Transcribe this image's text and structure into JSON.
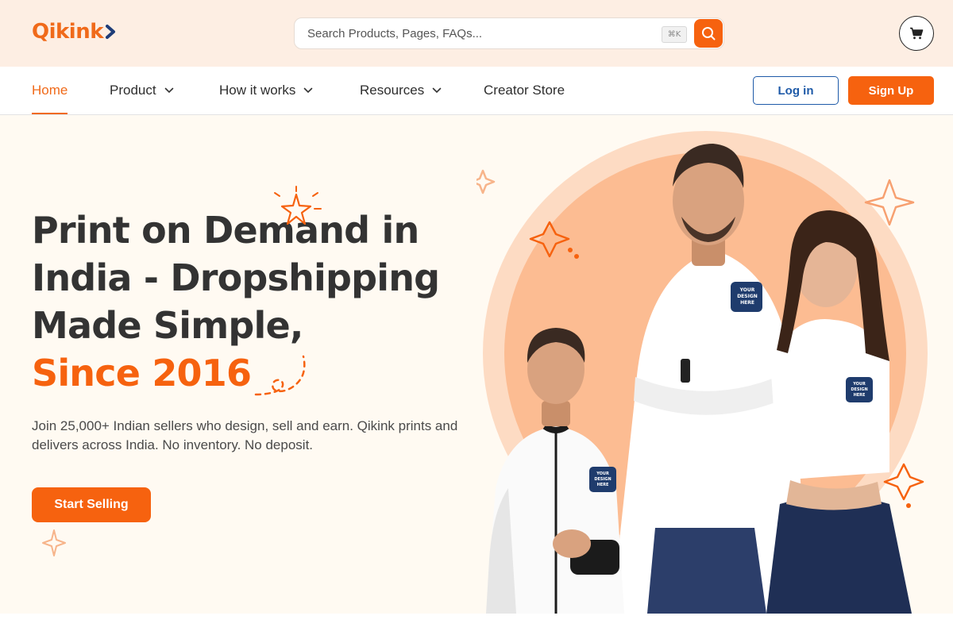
{
  "header": {
    "logo_text": "Qikink",
    "search": {
      "placeholder": "Search Products, Pages, FAQs...",
      "shortcut": "⌘K"
    }
  },
  "nav": {
    "items": [
      {
        "label": "Home",
        "active": true
      },
      {
        "label": "Product",
        "has_dropdown": true
      },
      {
        "label": "How it works",
        "has_dropdown": true
      },
      {
        "label": "Resources",
        "has_dropdown": true
      },
      {
        "label": "Creator Store",
        "has_dropdown": false
      }
    ],
    "login_label": "Log in",
    "signup_label": "Sign Up"
  },
  "hero": {
    "headline_lines": [
      "Print on Demand in",
      "India - Dropshipping",
      "Made Simple,"
    ],
    "highlight": "Since 2016",
    "subtext": "Join 25,000+ Indian sellers who design, sell and earn. Qikink prints and delivers across India. No inventory. No deposit.",
    "cta_label": "Start Selling",
    "tshirt_badge_text": "YOUR DESIGN HERE"
  },
  "colors": {
    "brand_orange": "#f6620f",
    "brand_blue": "#1e5aa8",
    "topbar_bg": "#fdeee3",
    "hero_bg": "#fffaf2",
    "circle_light": "#fdd6b8",
    "circle_inner": "#fcb58a"
  },
  "icons": {
    "search": "search-icon",
    "cart": "cart-icon",
    "dropdown": "chevron-down-icon"
  }
}
